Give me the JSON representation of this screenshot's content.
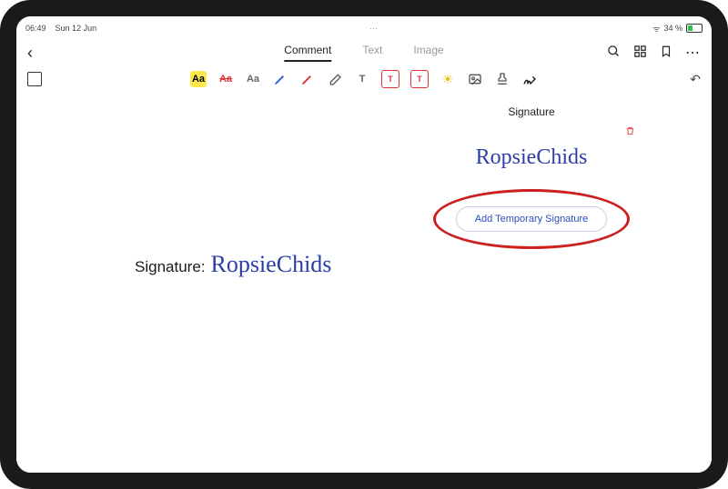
{
  "status": {
    "time": "06:49",
    "date": "Sun 12 Jun",
    "battery": "34 %"
  },
  "tabs": {
    "comment": "Comment",
    "text": "Text",
    "image": "Image"
  },
  "toolbar": {
    "Aa_highlighted": "Aa",
    "Aa_strike": "Aa",
    "Aa_gray": "Aa",
    "T_text": "T",
    "T_box1": "T",
    "T_box2": "T"
  },
  "signature_panel": {
    "title": "Signature",
    "saved_signature": "RopsieChids",
    "add_button": "Add Temporary Signature"
  },
  "document": {
    "signature_label": "Signature:",
    "signature_value": "RopsieChids"
  }
}
